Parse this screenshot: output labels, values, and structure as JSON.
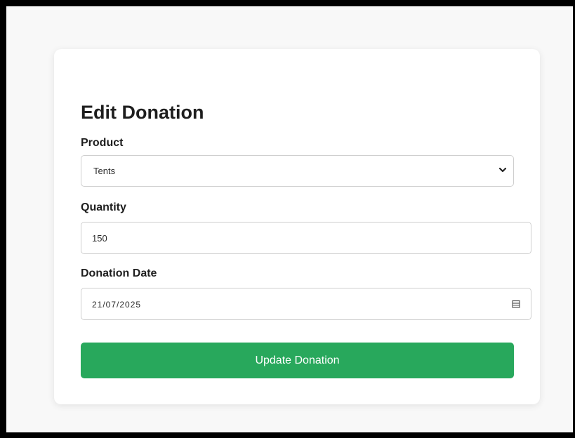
{
  "form": {
    "title": "Edit Donation",
    "product": {
      "label": "Product",
      "selected": "Tents"
    },
    "quantity": {
      "label": "Quantity",
      "value": "150"
    },
    "donation_date": {
      "label": "Donation Date",
      "value": "21/07/2025"
    },
    "submit_label": "Update Donation"
  },
  "icons": {
    "product_dropdown": "chevron-down-icon",
    "date_picker": "calendar-icon"
  },
  "colors": {
    "accent": "#28a85c",
    "card_background": "#ffffff",
    "page_background": "#f8f8f8",
    "frame": "#000000"
  }
}
